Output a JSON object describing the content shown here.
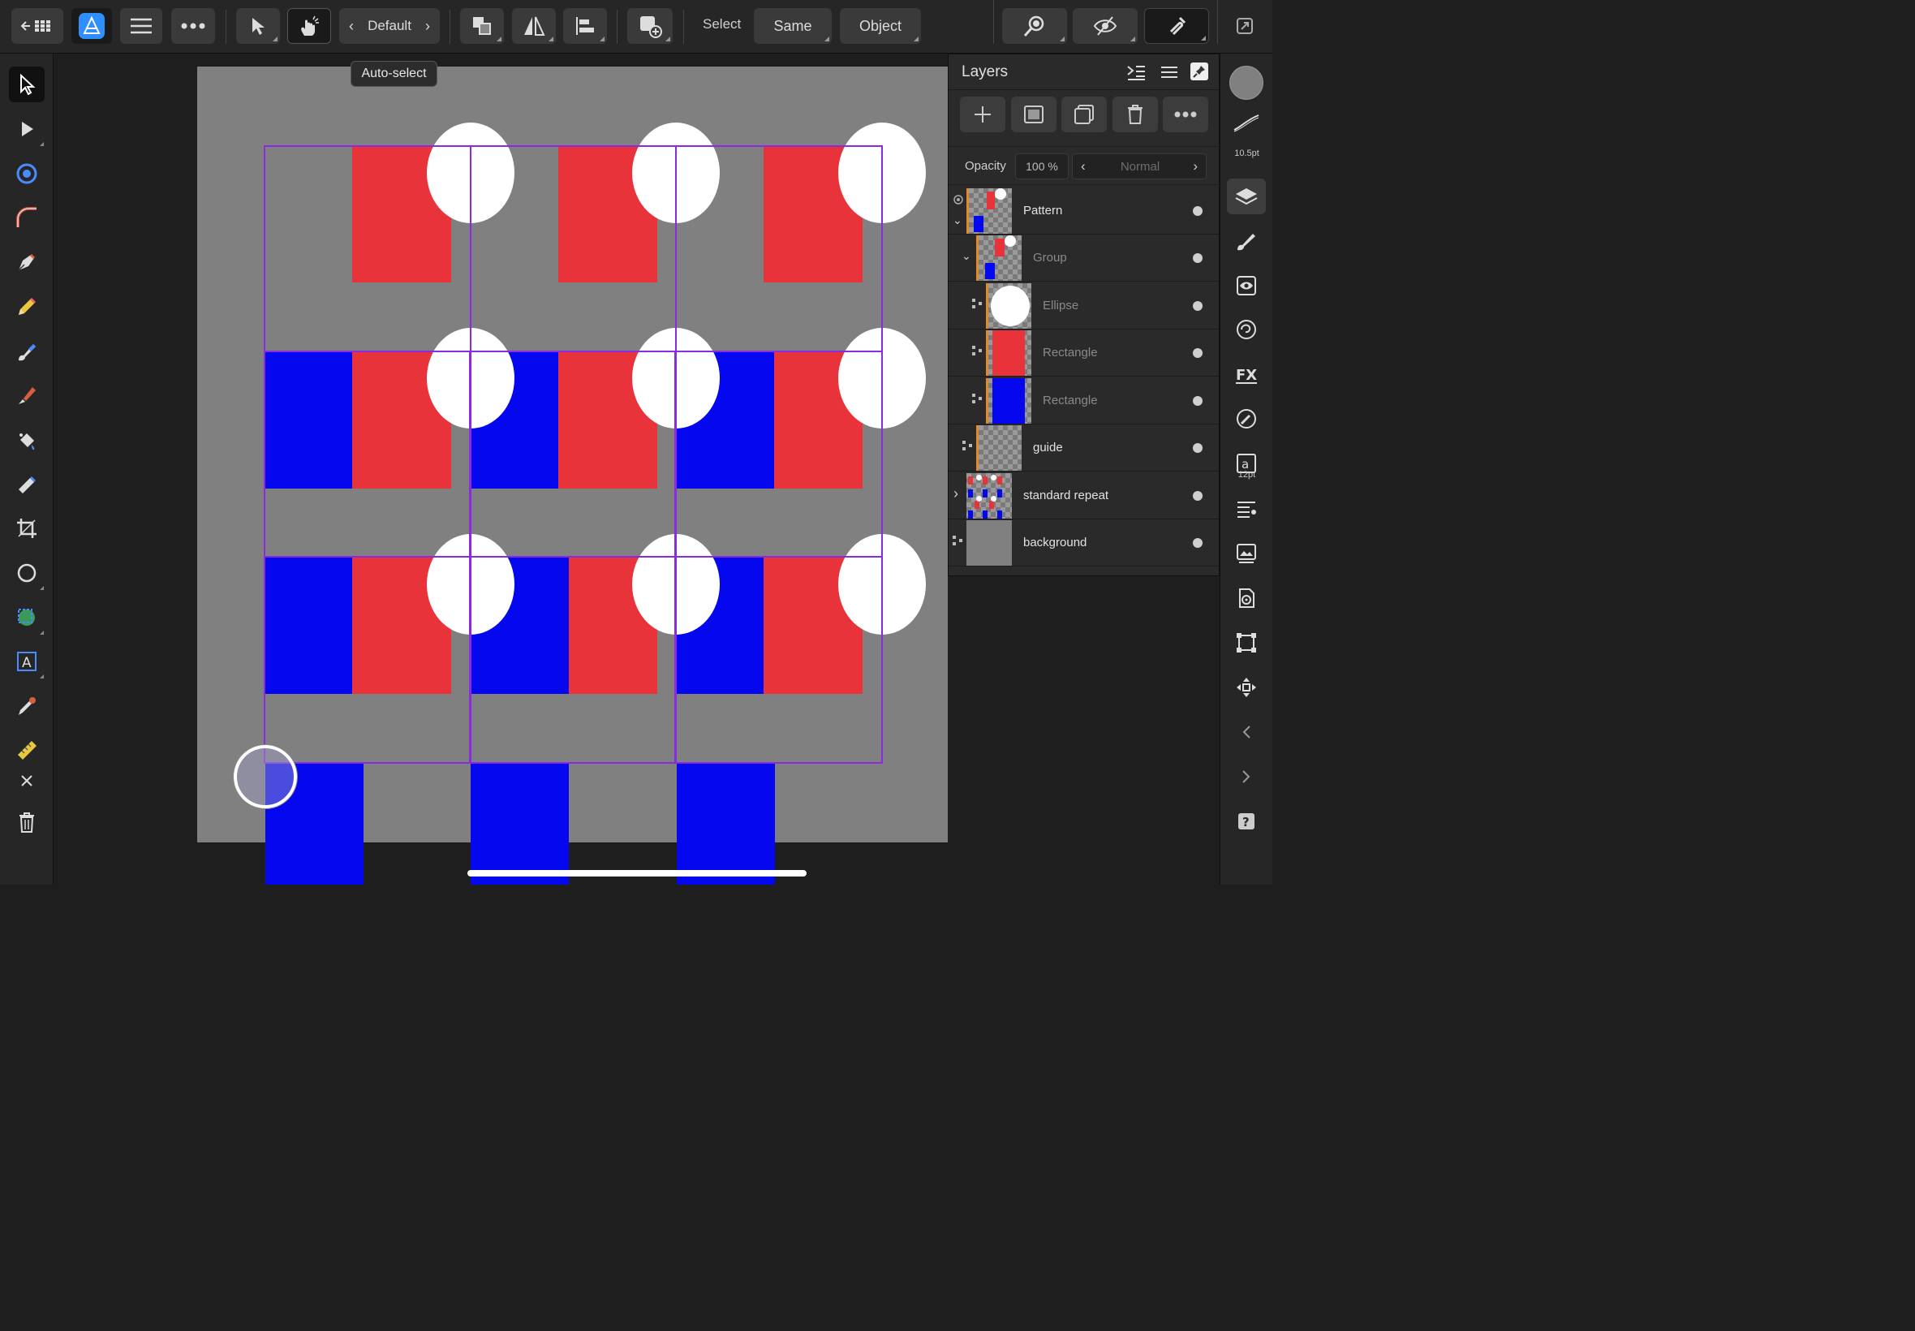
{
  "toolbar": {
    "persona_preset": "Default",
    "select_label": "Select",
    "same_button": "Same",
    "object_button": "Object",
    "tooltip": "Auto-select"
  },
  "layers_panel": {
    "title": "Layers",
    "opacity_label": "Opacity",
    "opacity_value": "100 %",
    "blend_mode": "Normal",
    "layers": [
      {
        "name": "Pattern",
        "dimmed": false
      },
      {
        "name": "Group",
        "dimmed": true
      },
      {
        "name": "Ellipse",
        "dimmed": true
      },
      {
        "name": "Rectangle",
        "dimmed": true
      },
      {
        "name": "Rectangle",
        "dimmed": true
      },
      {
        "name": "guide",
        "dimmed": false
      },
      {
        "name": "standard repeat",
        "dimmed": false
      },
      {
        "name": "background",
        "dimmed": false
      }
    ]
  },
  "studio": {
    "stroke_width": "10.5pt",
    "text_size": "12pt"
  },
  "colors": {
    "accent": "#2f8fff",
    "selection": "#8a2be2",
    "red": "#e8333a",
    "blue": "#0508ee",
    "background_fill": "#808080"
  }
}
